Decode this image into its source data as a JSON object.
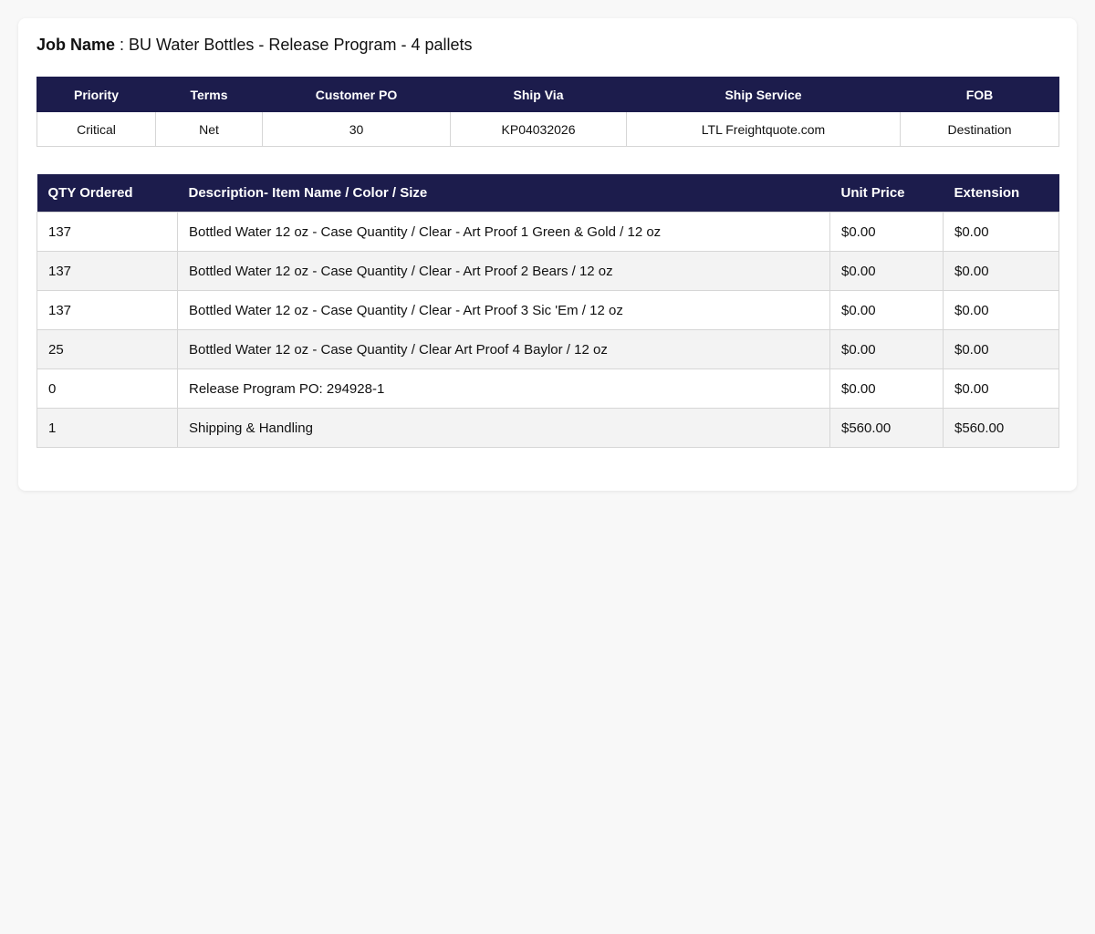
{
  "job": {
    "label": "Job Name",
    "value": " : BU Water Bottles - Release Program - 4 pallets"
  },
  "order_info": {
    "headers": [
      "Priority",
      "Terms",
      "Customer PO",
      "Ship Via",
      "Ship Service",
      "FOB"
    ],
    "values": [
      "Critical",
      "Net",
      "30",
      "KP04032026",
      "LTL Freightquote.com",
      "Destination"
    ]
  },
  "items": {
    "headers": [
      "QTY Ordered",
      "Description- Item Name / Color / Size",
      "Unit Price",
      "Extension"
    ],
    "rows": [
      {
        "qty": "137",
        "description": "Bottled Water 12 oz - Case Quantity / Clear - Art Proof 1 Green & Gold / 12 oz",
        "unit_price": "$0.00",
        "extension": "$0.00"
      },
      {
        "qty": "137",
        "description": "Bottled Water 12 oz - Case Quantity / Clear - Art Proof 2 Bears / 12 oz",
        "unit_price": "$0.00",
        "extension": "$0.00"
      },
      {
        "qty": "137",
        "description": "Bottled Water 12 oz - Case Quantity / Clear - Art Proof 3 Sic 'Em / 12 oz",
        "unit_price": "$0.00",
        "extension": "$0.00"
      },
      {
        "qty": "25",
        "description": "Bottled Water 12 oz - Case Quantity / Clear Art Proof 4 Baylor / 12 oz",
        "unit_price": "$0.00",
        "extension": "$0.00"
      },
      {
        "qty": "0",
        "description": "Release Program PO: 294928-1",
        "unit_price": "$0.00",
        "extension": "$0.00"
      },
      {
        "qty": "1",
        "description": "Shipping & Handling",
        "unit_price": "$560.00",
        "extension": "$560.00"
      }
    ]
  },
  "colors": {
    "header_bg": "#1c1c4c",
    "row_alt_bg": "#f3f3f3",
    "page_bg": "#f8f8f8"
  }
}
